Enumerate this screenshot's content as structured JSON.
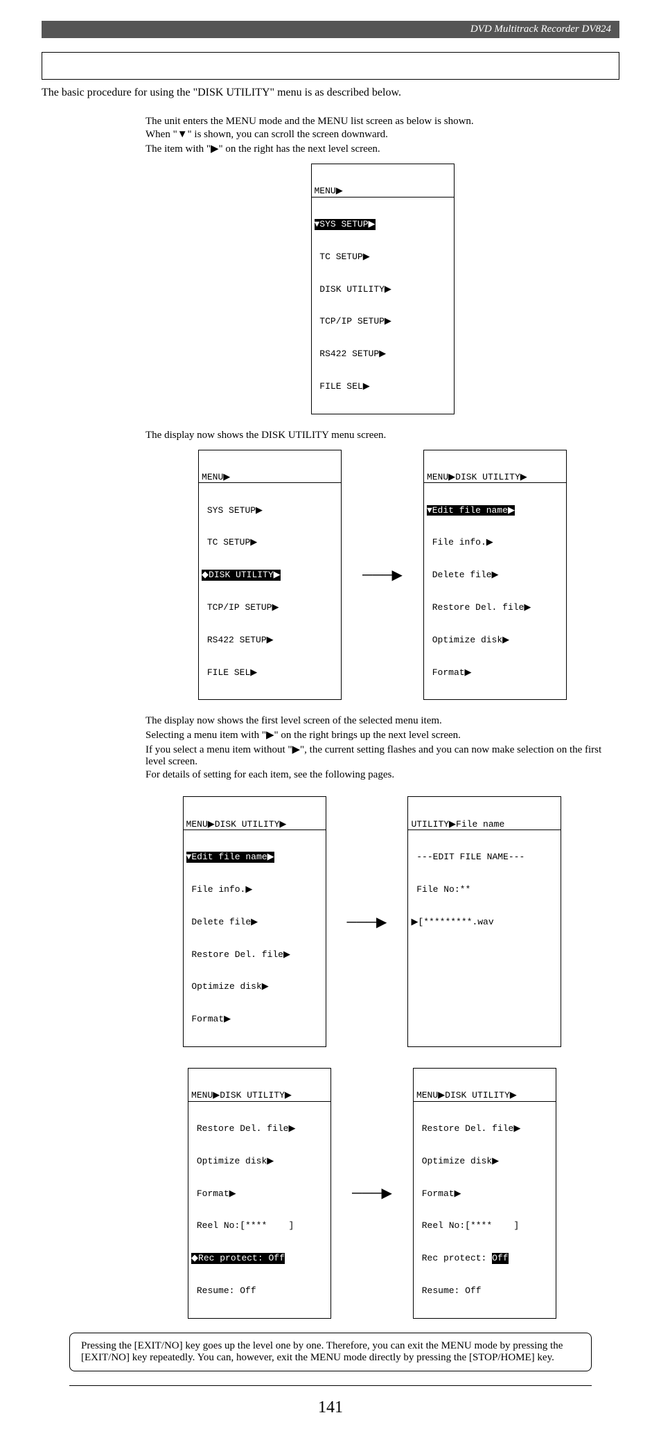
{
  "header": "DVD Multitrack Recorder DV824",
  "intro": "The basic procedure for using the \"DISK UTILITY\" menu is as described below.",
  "step1": {
    "l1": "The unit enters the MENU mode and the MENU list screen as below is shown.",
    "l2": "When \"▼\" is shown, you can scroll the screen downward.",
    "l3": "The item with \"▶\" on the right has the next level screen."
  },
  "lcd1": {
    "title": "MENU▶",
    "highlight": "▼SYS SETUP▶",
    "lines": [
      " TC SETUP▶",
      " DISK UTILITY▶",
      " TCP/IP SETUP▶",
      " RS422 SETUP▶",
      " FILE SEL▶"
    ]
  },
  "step2": {
    "l1": "The display now shows the DISK UTILITY menu screen."
  },
  "lcd2a": {
    "title": "MENU▶",
    "lines_before": [
      " SYS SETUP▶",
      " TC SETUP▶"
    ],
    "highlight": "◆DISK UTILITY▶",
    "lines_after": [
      " TCP/IP SETUP▶",
      " RS422 SETUP▶",
      " FILE SEL▶"
    ]
  },
  "lcd2b": {
    "title": "MENU▶DISK UTILITY▶",
    "highlight": "▼Edit file name▶",
    "lines": [
      " File info.▶",
      " Delete file▶",
      " Restore Del. file▶",
      " Optimize disk▶",
      " Format▶"
    ]
  },
  "step3": {
    "l1": "The display now shows the first level screen of the selected menu item.",
    "l2": "Selecting a menu item with \"▶\" on the right brings up the next level screen.",
    "l3": "If you select a menu item without \"▶\", the current setting flashes and you can now make selection on the first level screen.",
    "l4": "For details of setting for each item, see the following pages."
  },
  "lcd3a": {
    "title": "MENU▶DISK UTILITY▶",
    "highlight": "▼Edit file name▶",
    "lines": [
      " File info.▶",
      " Delete file▶",
      " Restore Del. file▶",
      " Optimize disk▶",
      " Format▶"
    ]
  },
  "lcd3b": {
    "title": "UTILITY▶File name",
    "lines": [
      " ---EDIT FILE NAME---",
      " File No:**",
      "▶[*********.wav"
    ]
  },
  "lcd4a": {
    "title": "MENU▶DISK UTILITY▶",
    "lines_before": [
      " Restore Del. file▶",
      " Optimize disk▶",
      " Format▶",
      " Reel No:[****    ]"
    ],
    "highlight": "◆Rec protect: Off",
    "lines_after": [
      " Resume: Off"
    ]
  },
  "lcd4b": {
    "title": "MENU▶DISK UTILITY▶",
    "lines_before": [
      " Restore Del. file▶",
      " Optimize disk▶",
      " Format▶",
      " Reel No:[****    ]"
    ],
    "pro_prefix": " Rec protect: ",
    "pro_val": "Off",
    "lines_after": [
      " Resume: Off"
    ]
  },
  "note": "Pressing the [EXIT/NO] key goes up the level one by one. Therefore, you can exit the MENU mode by pressing the [EXIT/NO] key repeatedly. You can, however, exit the MENU mode directly by pressing the [STOP/HOME] key.",
  "pagenum": "141"
}
